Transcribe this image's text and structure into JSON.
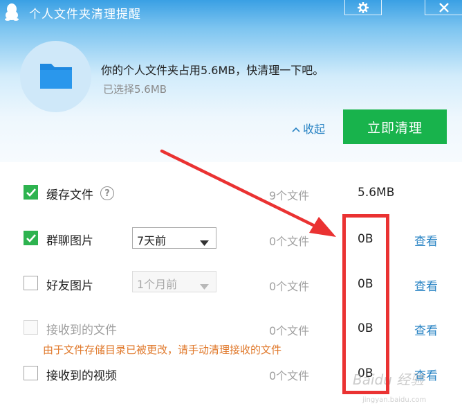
{
  "window": {
    "title": "个人文件夹清理提醒"
  },
  "header": {
    "headline": "你的个人文件夹占用5.6MB，快清理一下吧。",
    "selected": "已选择5.6MB",
    "collapse_label": "收起",
    "clean_button": "立即清理"
  },
  "items": [
    {
      "label": "缓存文件",
      "checked": true,
      "disabled": false,
      "count": "9个文件",
      "size": "5.6MB",
      "view": ""
    },
    {
      "label": "群聊图片",
      "checked": true,
      "disabled": false,
      "dropdown": "7天前",
      "count": "0个文件",
      "size": "0B",
      "view": "查看"
    },
    {
      "label": "好友图片",
      "checked": false,
      "disabled": false,
      "dropdown": "1个月前",
      "count": "0个文件",
      "size": "0B",
      "view": "查看"
    },
    {
      "label": "接收到的文件",
      "checked": false,
      "disabled": true,
      "count": "0个文件",
      "size": "0B",
      "view": "查看"
    },
    {
      "label": "接收到的视频",
      "checked": false,
      "disabled": false,
      "count": "0个文件",
      "size": "0B",
      "view": "查看"
    }
  ],
  "warning": "由于文件存储目录已被更改，请手动清理接收的文件",
  "watermark": {
    "brand": "Baidu 经验",
    "url": "jingyan.baidu.com"
  },
  "colors": {
    "accent_blue": "#2a84c4",
    "clean_green": "#18b34c",
    "check_green": "#2db34f",
    "warning_orange": "#e0782a",
    "annotation_red": "#ea3232"
  },
  "icons": [
    "qq-penguin-icon",
    "gear-icon",
    "close-icon",
    "folder-icon",
    "chevron-up-icon",
    "help-icon",
    "checkmark-icon",
    "dropdown-arrow-icon"
  ]
}
